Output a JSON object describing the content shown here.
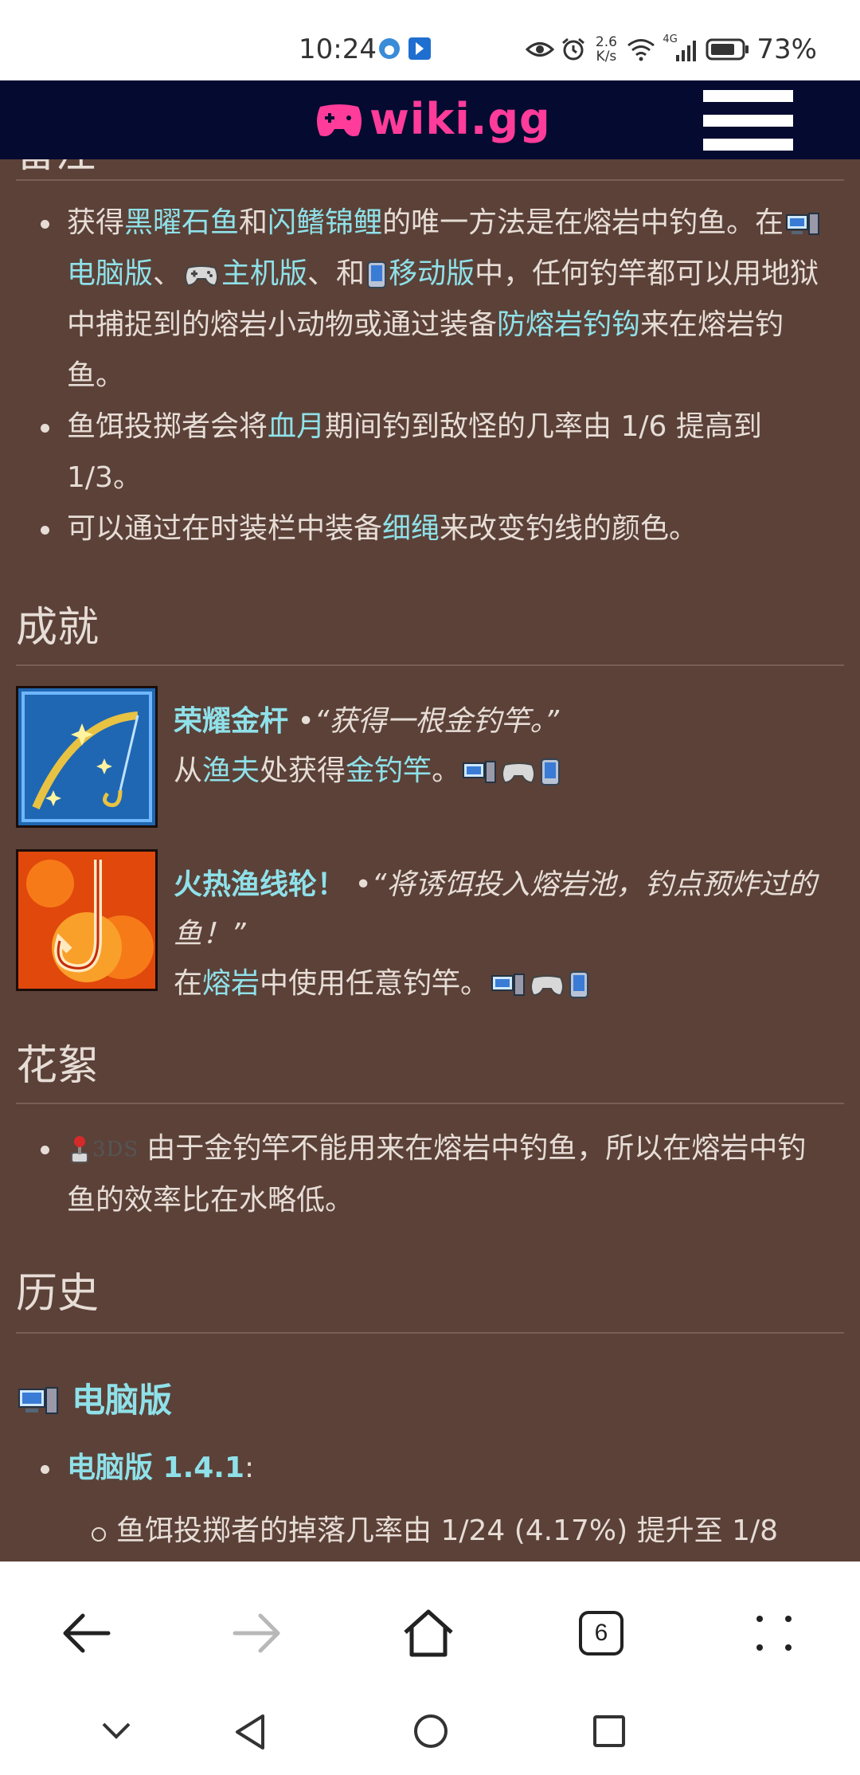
{
  "status_bar": {
    "time": "10:24",
    "net_speed_value": "2.6",
    "net_speed_unit": "K/s",
    "network": "4G",
    "battery": "73%"
  },
  "header": {
    "logo_text": "wiki.gg"
  },
  "cut_heading": "备注",
  "notes": [
    {
      "t1": "获得",
      "l1": "黑曜石鱼",
      "t2": "和",
      "l2": "闪鳍锦鲤",
      "t3": "的唯一方法是在熔岩中钓鱼。在",
      "l_pc": "电脑版",
      "t4": "、",
      "l_console": "主机版",
      "t5": "、和",
      "l_mobile": "移动版",
      "t6": "中，任何钓竿都可以用地狱中捕捉到的熔岩小动物或通过装备",
      "l3": "防熔岩钓钩",
      "t7": "来在熔岩钓鱼。"
    },
    {
      "t1": "鱼饵投掷者会将",
      "l1": "血月",
      "t2": "期间钓到敌怪的几率由 1/6 提高到 1/3。"
    },
    {
      "t1": "可以通过在时装栏中装备",
      "l1": "细绳",
      "t2": "来改变钓线的颜色。"
    }
  ],
  "achievements_heading": "成就",
  "achievements": [
    {
      "name": "荣耀金杆",
      "sep": "•",
      "quote": "“获得一根金钓竿。”",
      "d1": "从",
      "dl1": "渔夫",
      "d2": "处获得",
      "dl2": "金钓竿",
      "d3": "。",
      "icon": "golden-rod-icon"
    },
    {
      "name": "火热渔线轮！",
      "sep": "•",
      "quote": "“将诱饵投入熔岩池，钓点预炸过的鱼！”",
      "d1": "在",
      "dl1": "熔岩",
      "d2": "中使用任意钓竿。",
      "icon": "lava-hook-icon"
    }
  ],
  "trivia_heading": "花絮",
  "trivia": {
    "platform_label": "3DS",
    "text": "由于金钓竿不能用来在熔岩中钓鱼，所以在熔岩中钓鱼的效率比在水略低。"
  },
  "history_heading": "历史",
  "history": {
    "platform_heading": "电脑版",
    "version_link": "电脑版 1.4.1",
    "version_colon": ":",
    "change": "鱼饵投掷者的掉落几率由 1/24 (4.17%) 提升至 1/8"
  },
  "browser_nav": {
    "tab_count": "6"
  },
  "colors": {
    "content_bg": "#5b4138",
    "link": "#8fe1e9",
    "header_bg": "#050a30",
    "logo": "#ff3c9a"
  }
}
